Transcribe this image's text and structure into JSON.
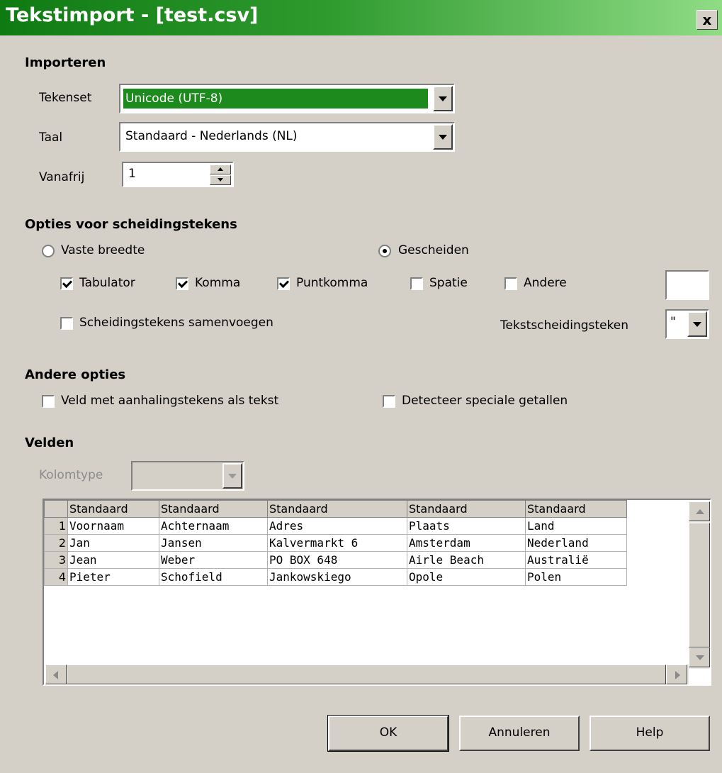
{
  "window": {
    "title": "Tekstimport - [test.csv]",
    "close_label": "x"
  },
  "importeren": {
    "heading": "Importeren",
    "tekenset": {
      "label": "Tekenset",
      "value": "Unicode (UTF-8)"
    },
    "taal": {
      "label": "Taal",
      "value": "Standaard - Nederlands (NL)"
    },
    "vanafrij": {
      "label": "Vanafrij",
      "value": "1"
    }
  },
  "scheiding": {
    "heading": "Opties voor scheidingstekens",
    "vaste_breedte": {
      "label": "Vaste breedte",
      "selected": false
    },
    "gescheiden": {
      "label": "Gescheiden",
      "selected": true
    },
    "tabulator": {
      "label": "Tabulator",
      "checked": true
    },
    "komma": {
      "label": "Komma",
      "checked": true
    },
    "puntkomma": {
      "label": "Puntkomma",
      "checked": true
    },
    "spatie": {
      "label": "Spatie",
      "checked": false
    },
    "andere": {
      "label": "Andere",
      "checked": false,
      "value": ""
    },
    "samenvoegen": {
      "label": "Scheidingstekens samenvoegen",
      "checked": false
    },
    "tekstscheidingsteken": {
      "label": "Tekstscheidingsteken",
      "value": "\""
    }
  },
  "andere_opties": {
    "heading": "Andere opties",
    "veld_aanhalingstekens": {
      "label": "Veld met aanhalingstekens als tekst",
      "checked": false
    },
    "speciale_getallen": {
      "label": "Detecteer speciale getallen",
      "checked": false
    }
  },
  "velden": {
    "heading": "Velden",
    "kolomtype": {
      "label": "Kolomtype",
      "value": ""
    },
    "headers": [
      "Standaard",
      "Standaard",
      "Standaard",
      "Standaard",
      "Standaard"
    ],
    "rows": [
      {
        "num": "1",
        "cells": [
          "Voornaam",
          "Achternaam",
          "Adres",
          "Plaats",
          "Land"
        ]
      },
      {
        "num": "2",
        "cells": [
          "Jan",
          "Jansen",
          "Kalvermarkt 6",
          "Amsterdam",
          "Nederland"
        ]
      },
      {
        "num": "3",
        "cells": [
          "Jean",
          "Weber",
          "PO BOX 648",
          "Airle Beach",
          "Australië"
        ]
      },
      {
        "num": "4",
        "cells": [
          "Pieter",
          "Schofield",
          "Jankowskiego",
          "Opole",
          "Polen"
        ]
      }
    ]
  },
  "buttons": {
    "ok": "OK",
    "annuleren": "Annuleren",
    "help": "Help"
  }
}
